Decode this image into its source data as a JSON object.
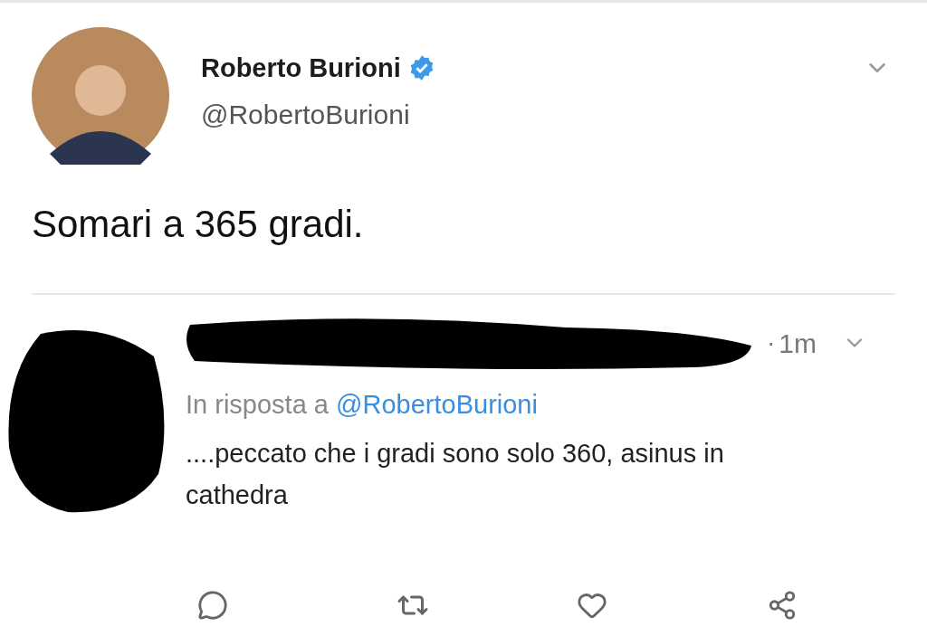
{
  "tweet": {
    "name": "Roberto Burioni",
    "verified": true,
    "handle": "@RobertoBurioni",
    "text": "Somari a 365 gradi."
  },
  "reply": {
    "separator": "·",
    "time": "1m",
    "reply_label": "In risposta a",
    "reply_to": "@RobertoBurioni",
    "text": "....peccato che i gradi sono solo 360, asinus in cathedra"
  }
}
